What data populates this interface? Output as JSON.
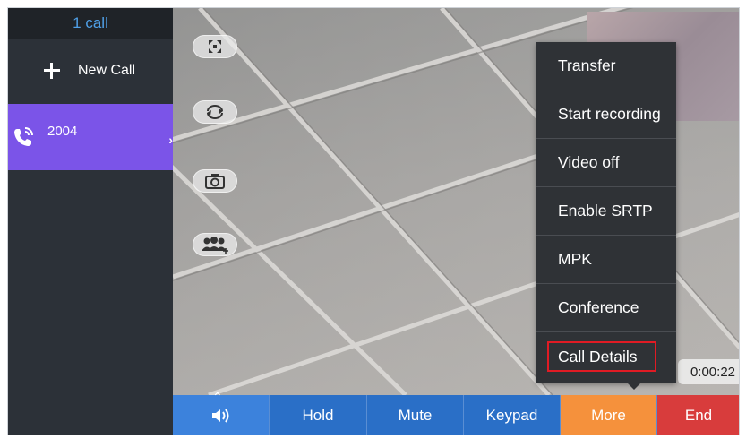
{
  "sidebar": {
    "header": "1 call",
    "new_call_label": "New Call",
    "active_call_number": "2004"
  },
  "call_controls": {
    "fullscreen_icon": "fullscreen-icon",
    "swap_icon": "swap-camera-icon",
    "snapshot_icon": "camera-icon",
    "conference_icon": "add-participants-icon"
  },
  "timer": "0:00:22",
  "more_menu": {
    "items": [
      {
        "label": "Transfer"
      },
      {
        "label": "Start recording"
      },
      {
        "label": "Video off"
      },
      {
        "label": "Enable SRTP"
      },
      {
        "label": "MPK"
      },
      {
        "label": "Conference"
      },
      {
        "label": "Call Details"
      }
    ],
    "highlighted_item": "Call Details"
  },
  "bottom_bar": {
    "volume_icon": "volume-icon",
    "hold": "Hold",
    "mute": "Mute",
    "keypad": "Keypad",
    "more": "More",
    "end": "End"
  },
  "colors": {
    "sidebar_bg": "#2c3138",
    "active_call_bg": "#7b54e8",
    "bar_blue": "#2a6fc7",
    "more_orange": "#f5913c",
    "end_red": "#d83c3c",
    "highlight_red": "#e01b24"
  }
}
